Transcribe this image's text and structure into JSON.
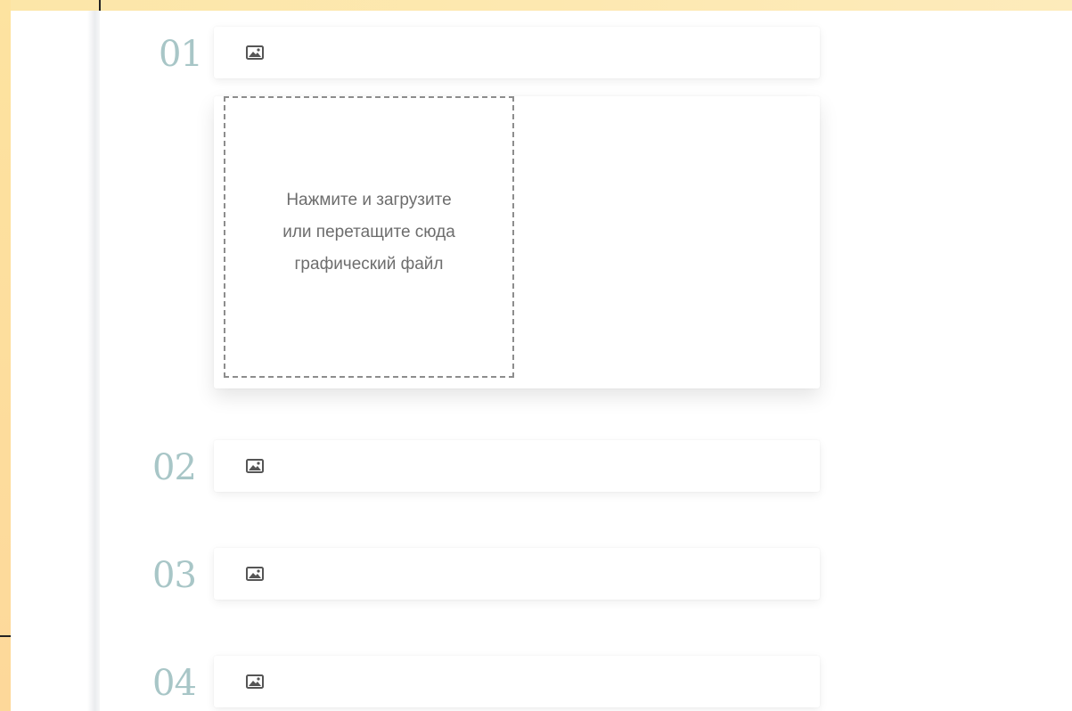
{
  "steps": [
    {
      "number": "01",
      "icon": "image-icon",
      "expanded": true
    },
    {
      "number": "02",
      "icon": "image-icon",
      "expanded": false
    },
    {
      "number": "03",
      "icon": "image-icon",
      "expanded": false
    },
    {
      "number": "04",
      "icon": "image-icon",
      "expanded": false
    }
  ],
  "upload": {
    "line1": "Нажмите и загрузите",
    "line2": "или перетащите сюда",
    "line3": "графический файл"
  },
  "colors": {
    "frame": "#fde8b0",
    "step_number": "#a8c6c7",
    "upload_text": "#6d6d6d",
    "dashed_border": "#8d8d8d"
  }
}
